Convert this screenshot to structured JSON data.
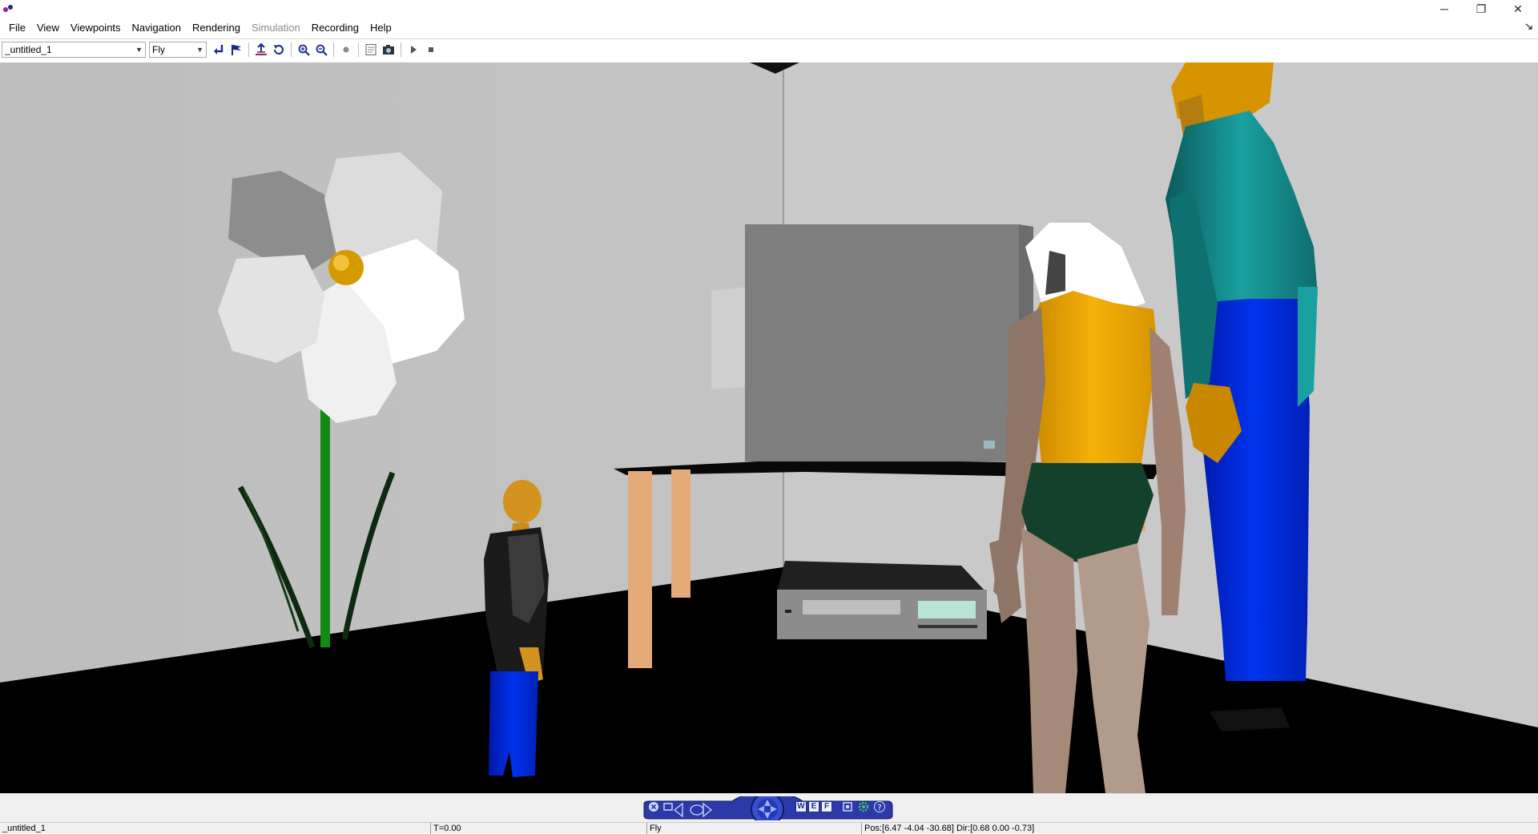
{
  "titlebar": {
    "minimize_glyph": "─",
    "restore_glyph": "❐",
    "close_glyph": "✕"
  },
  "menu": {
    "items": [
      {
        "label": "File",
        "enabled": true
      },
      {
        "label": "View",
        "enabled": true
      },
      {
        "label": "Viewpoints",
        "enabled": true
      },
      {
        "label": "Navigation",
        "enabled": true
      },
      {
        "label": "Rendering",
        "enabled": true
      },
      {
        "label": "Simulation",
        "enabled": false
      },
      {
        "label": "Recording",
        "enabled": true
      },
      {
        "label": "Help",
        "enabled": true
      }
    ]
  },
  "toolbar": {
    "world_select": "_untitled_1",
    "navigation_mode": "Fly",
    "icons": [
      "undo-arrow-icon",
      "flag-icon",
      "go-home-icon",
      "restore-view-icon",
      "zoom-in-icon",
      "zoom-out-icon",
      "record-icon",
      "document-icon",
      "camera-icon",
      "play-icon",
      "stop-icon"
    ]
  },
  "nav_panel": {
    "letters": [
      "W",
      "E",
      "F"
    ],
    "help": "?"
  },
  "status": {
    "world": "_untitled_1",
    "time": "T=0.00",
    "mode": "Fly",
    "position": "Pos:[6.47 -4.04 -30.68] Dir:[0.68 0.00 -0.73]"
  },
  "colors": {
    "accent_blue": "#1d2a8c",
    "nav_blue": "#2b3aa8",
    "wall": "#c0c0c0",
    "floor": "#000000"
  }
}
